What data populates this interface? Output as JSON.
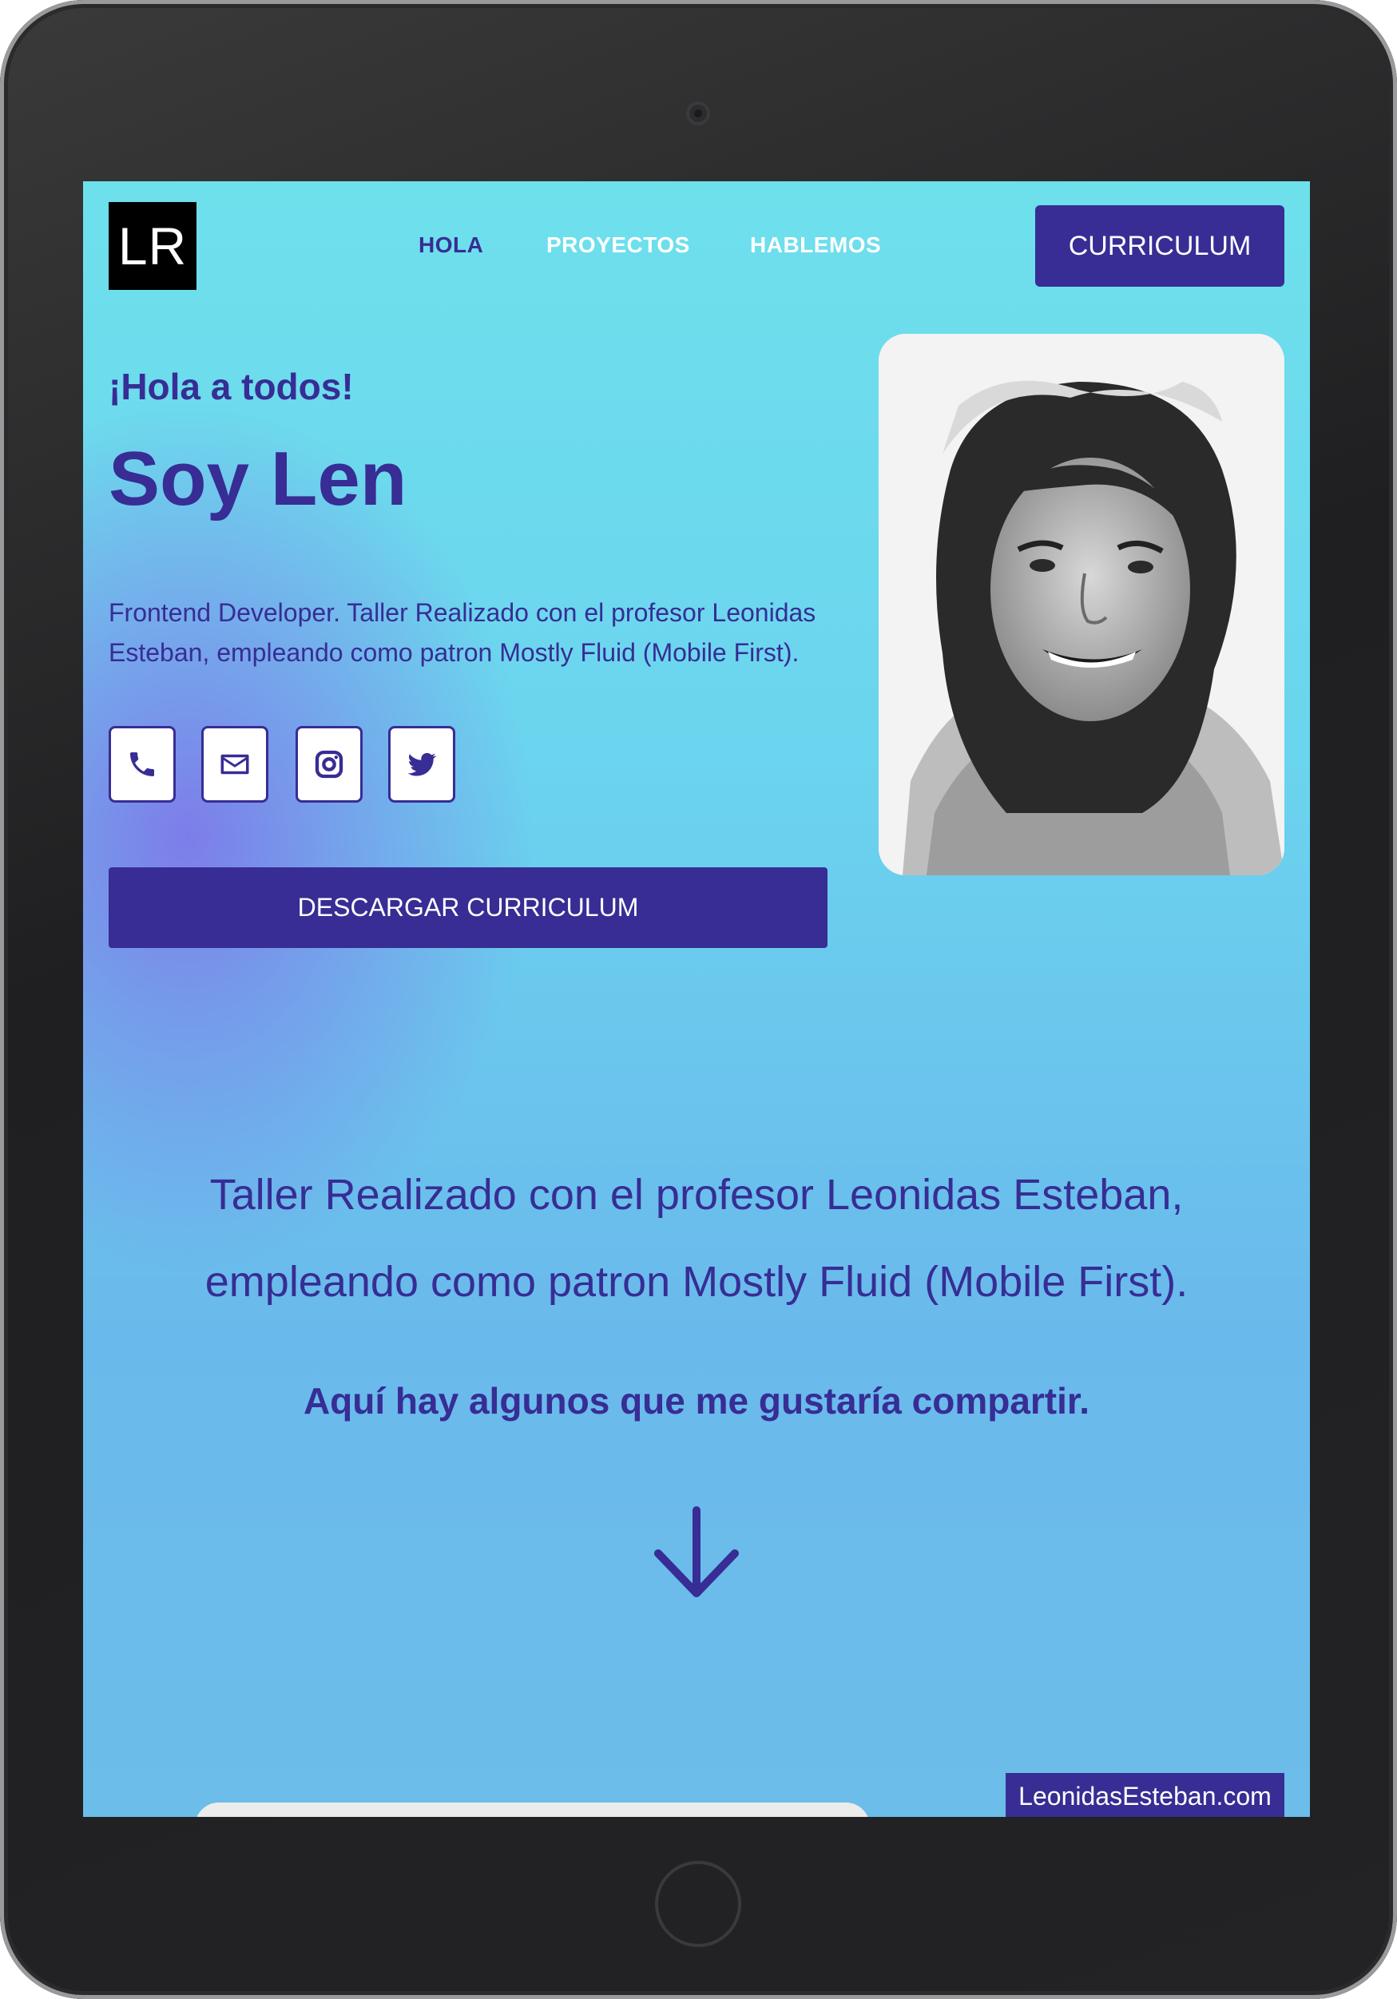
{
  "header": {
    "logo_text": "LR",
    "nav": [
      {
        "label": "HOLA",
        "active": true
      },
      {
        "label": "PROYECTOS",
        "active": false
      },
      {
        "label": "HABLEMOS",
        "active": false
      }
    ],
    "cv_button": "CURRICULUM"
  },
  "hero": {
    "greeting": "¡Hola a todos!",
    "name": "Soy Len",
    "description": "Frontend Developer. Taller Realizado con el profesor Leonidas Esteban, empleando como patron Mostly Fluid (Mobile First).",
    "social_icons": [
      "phone-icon",
      "mail-icon",
      "instagram-icon",
      "twitter-icon"
    ],
    "download_button": "DESCARGAR CURRICULUM",
    "photo": "portrait-photo"
  },
  "intro": {
    "line1": "Taller Realizado con el profesor Leonidas Esteban,",
    "line2": "empleando como patron Mostly Fluid (Mobile First).",
    "share": "Aquí hay algunos que me gustaría compartir.",
    "arrow_icon": "arrow-down-icon"
  },
  "credit": "LeonidasEsteban.com",
  "colors": {
    "primary": "#372d94",
    "bg_top": "#6ee0ec",
    "bg_bottom": "#6ab9ec",
    "accent_purple": "#806ee8",
    "device_frame": "#1f1f21"
  }
}
